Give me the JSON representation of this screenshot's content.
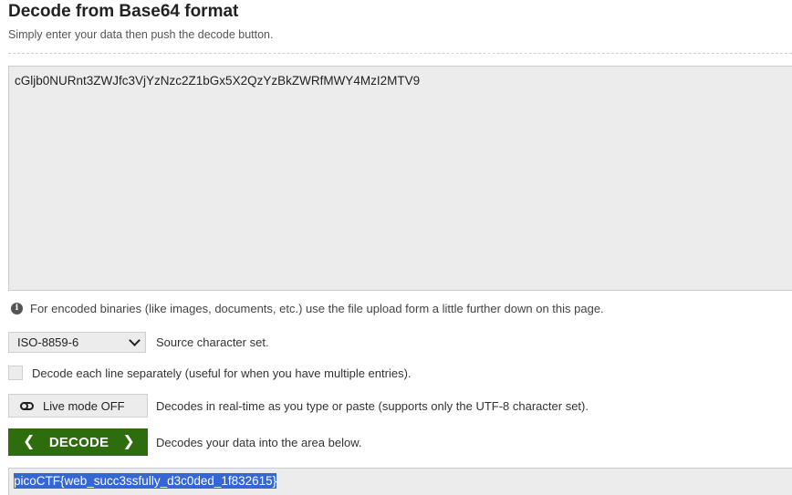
{
  "header": {
    "title": "Decode from Base64 format",
    "subtitle": "Simply enter your data then push the decode button."
  },
  "input": {
    "value": "cGljb0NURnt3ZWJfc3VjYzNzc2Z1bGx5X2QzYzBkZWRfMWY4MzI2MTV9"
  },
  "info": {
    "icon": "info-icon",
    "text": "For encoded binaries (like images, documents, etc.) use the file upload form a little further down on this page."
  },
  "charset": {
    "selected": "ISO-8859-6",
    "label": "Source character set."
  },
  "line_option": {
    "checked": false,
    "label": "Decode each line separately (useful for when you have multiple entries)."
  },
  "live_mode": {
    "button_label": "Live mode OFF",
    "description": "Decodes in real-time as you type or paste (supports only the UTF-8 character set)."
  },
  "decode": {
    "button_label": "DECODE",
    "description": "Decodes your data into the area below.",
    "color": "#2e6d0e"
  },
  "output": {
    "value": "picoCTF{web_succ3ssfully_d3c0ded_1f832615}",
    "selection_color": "#3367d6"
  }
}
